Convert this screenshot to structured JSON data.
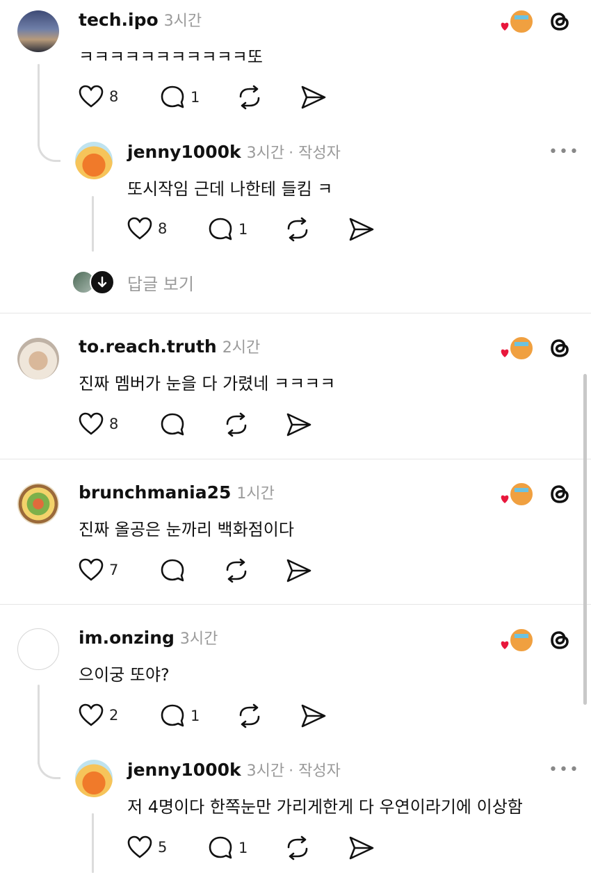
{
  "posts": [
    {
      "username": "tech.ipo",
      "time": "3시간",
      "text": "ㅋㅋㅋㅋㅋㅋㅋㅋㅋㅋㅋ또",
      "likes": "8",
      "comments": "1",
      "reply": {
        "username": "jenny1000k",
        "time": "3시간",
        "author_tag": "· 작성자",
        "text": "또시작임 근데  나한테 들킴 ㅋ",
        "likes": "8",
        "comments": "1"
      },
      "view_replies": "답글 보기"
    },
    {
      "username": "to.reach.truth",
      "time": "2시간",
      "text": "진짜 멤버가 눈을 다 가렸네 ㅋㅋㅋㅋ",
      "likes": "8"
    },
    {
      "username": "brunchmania25",
      "time": "1시간",
      "text": "진짜 올공은 눈까리 백화점이다",
      "likes": "7"
    },
    {
      "username": "im.onzing",
      "time": "3시간",
      "text": "으이궁 또야?",
      "likes": "2",
      "comments": "1",
      "reply": {
        "username": "jenny1000k",
        "time": "3시간",
        "author_tag": "· 작성자",
        "text": "저 4명이다 한쪽눈만 가리게한게 다 우연이라기에 이상함",
        "likes": "5",
        "comments": "1"
      }
    }
  ],
  "more_label": "•••",
  "colors": {
    "heart": "#e8173c",
    "text": "#111111",
    "meta": "#9a9a9a"
  },
  "icons": [
    "heart-icon",
    "comment-icon",
    "repost-icon",
    "share-icon",
    "threads-logo-icon",
    "down-arrow-icon"
  ]
}
